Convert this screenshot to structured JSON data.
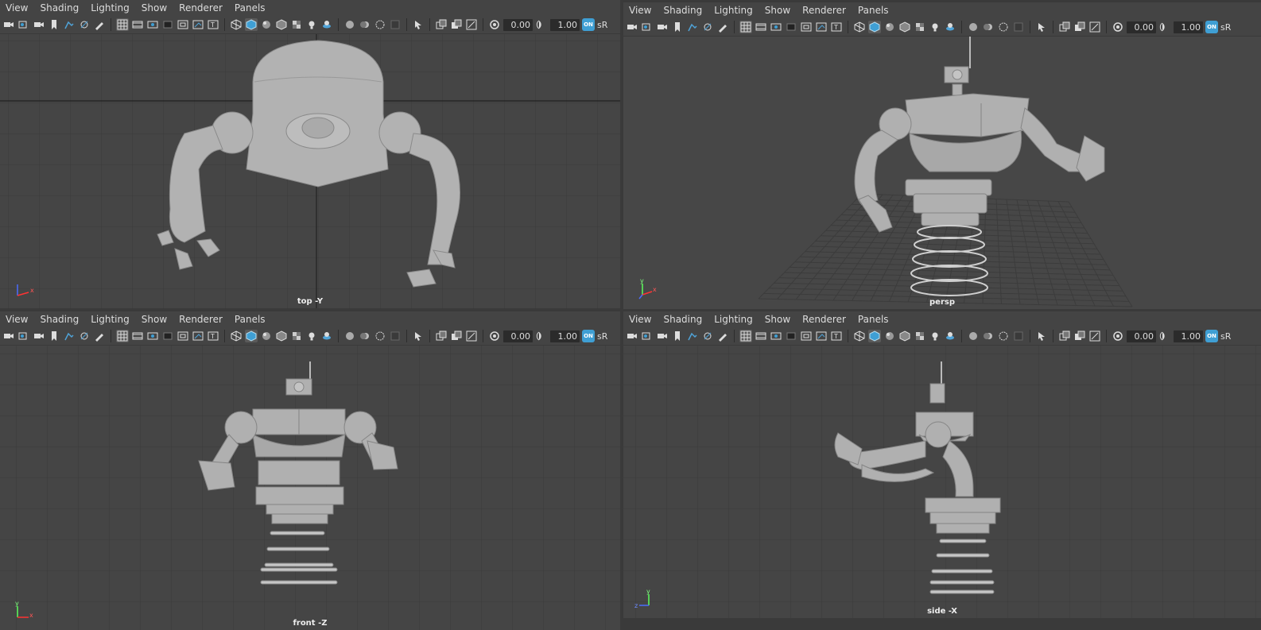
{
  "menus": [
    "View",
    "Shading",
    "Lighting",
    "Show",
    "Renderer",
    "Panels"
  ],
  "toolbar": {
    "exposure": "0.00",
    "gamma": "1.00",
    "on_label": "ON",
    "colorspace": "sR"
  },
  "panels": {
    "top": {
      "camera_label": "top -Y",
      "axis": {
        "v": "",
        "h": "x"
      }
    },
    "persp": {
      "camera_label": "persp",
      "axis": {
        "v": "y",
        "h": "x"
      }
    },
    "front": {
      "camera_label": "front -Z",
      "axis": {
        "v": "y",
        "h": "x"
      }
    },
    "side": {
      "camera_label": "side -X",
      "axis": {
        "v": "y",
        "h": "z"
      }
    }
  },
  "colors": {
    "bg": "#444444",
    "grid": "#383838",
    "accent": "#3f9fd4",
    "model": "#b0b0b0"
  },
  "icons": [
    "camera-icon",
    "gear-icon",
    "grid-icon",
    "wireframe-icon",
    "shaded-icon",
    "lighting-icon",
    "isolate-icon",
    "xray-icon",
    "exposure-icon",
    "gamma-icon",
    "color-management-icon"
  ]
}
